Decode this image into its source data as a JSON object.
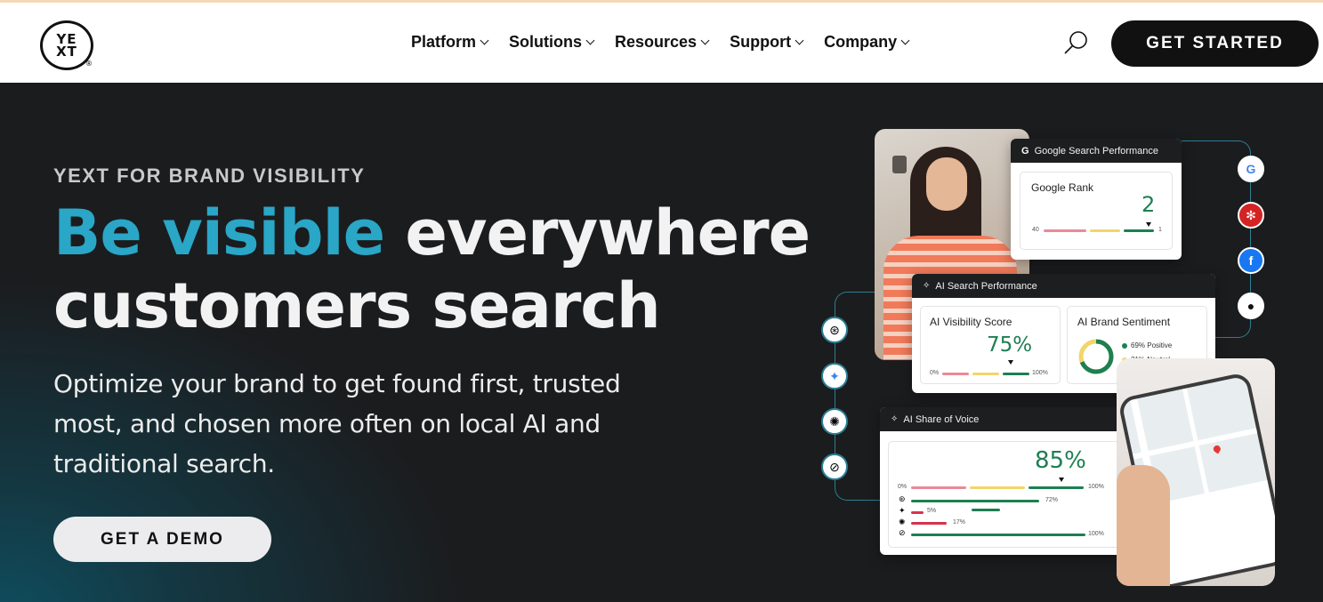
{
  "header": {
    "logo_line1": "YE",
    "logo_line2": "XT",
    "logo_reg": "®",
    "nav": [
      {
        "label": "Platform"
      },
      {
        "label": "Solutions"
      },
      {
        "label": "Resources"
      },
      {
        "label": "Support"
      },
      {
        "label": "Company"
      }
    ],
    "cta": "GET STARTED",
    "search_icon": "search-icon"
  },
  "hero": {
    "eyebrow": "YEXT FOR BRAND VISIBILITY",
    "headline_accent": "Be visible",
    "headline_rest1": " everywhere",
    "headline_rest2": "customers search",
    "subtext": "Optimize your brand to get found first, trusted most, and chosen more often on local AI and traditional search.",
    "cta": "GET A DEMO"
  },
  "graphic": {
    "google_card": {
      "title": "Google Search Performance",
      "metric": "Google Rank",
      "value": "2",
      "min": "40",
      "max": "1"
    },
    "ai_card": {
      "title": "AI Search Performance",
      "visibility_label": "AI Visibility Score",
      "visibility_value": "75%",
      "min": "0%",
      "max": "100%",
      "sentiment_label": "AI Brand Sentiment",
      "positive": "69% Positive",
      "neutral": "31% Neutral",
      "positive_share": 0.69
    },
    "voice_card": {
      "title": "AI Share of Voice",
      "value": "85%",
      "min": "0%",
      "max": "100%",
      "rows": [
        {
          "value": "72%"
        },
        {
          "value": "5%"
        },
        {
          "value": "17%"
        },
        {
          "value": "100%"
        }
      ]
    },
    "left_icons": [
      "chatgpt-icon",
      "gemini-icon",
      "perplexity-icon",
      "copilot-icon"
    ],
    "right_icons": [
      "google-icon",
      "yelp-icon",
      "facebook-icon",
      "apple-icon"
    ],
    "colors": {
      "accent": "#2aa6c7",
      "green": "#1d7f52",
      "pink": "#e98a97",
      "yellow": "#f2d56b"
    }
  }
}
